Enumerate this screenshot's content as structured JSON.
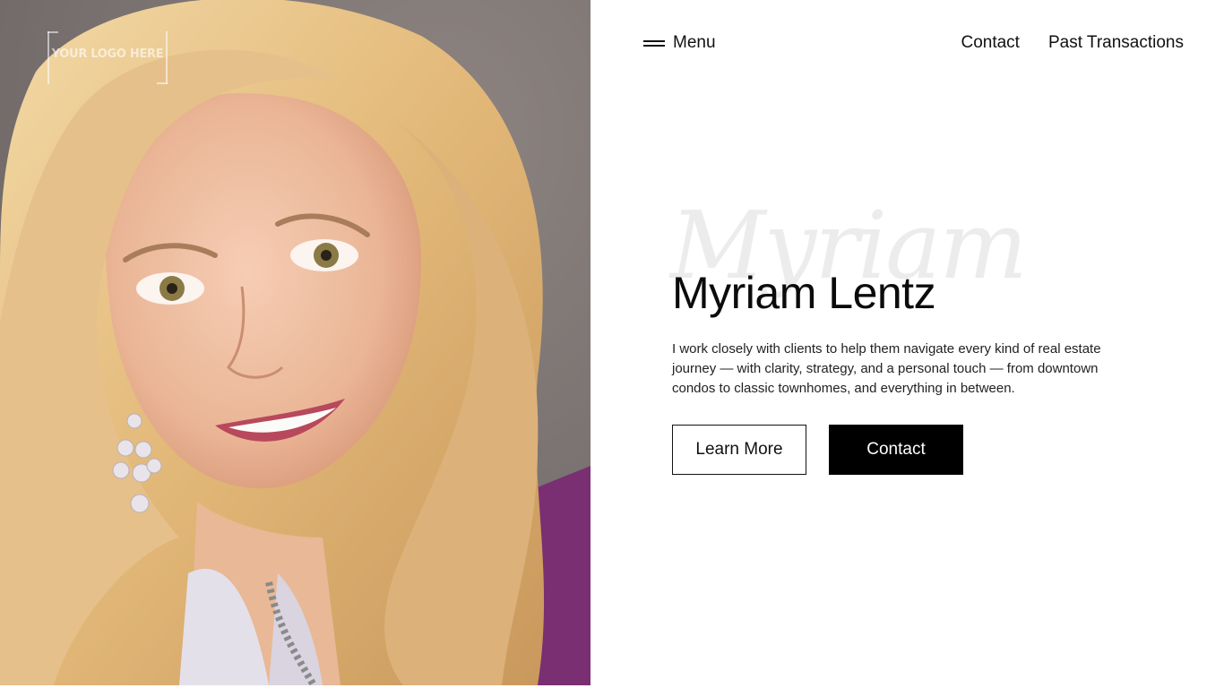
{
  "logo": {
    "text": "YOUR LOGO HERE"
  },
  "portrait": {
    "subject": "Myriam Lentz portrait photo"
  },
  "nav": {
    "menu_label": "Menu",
    "links": [
      "Contact",
      "Past Transactions"
    ]
  },
  "hero": {
    "script_text": "Myriam",
    "title": "Myriam Lentz",
    "description": "I work closely with clients to help them navigate every kind of real estate journey — with clarity, strategy, and a personal touch — from downtown condos to classic townhomes, and everything in between.",
    "learn_more_label": "Learn More",
    "contact_label": "Contact"
  },
  "colors": {
    "background": "#ffffff",
    "text": "#111111",
    "button_dark": "#000000",
    "script_watermark": "#ececec"
  }
}
